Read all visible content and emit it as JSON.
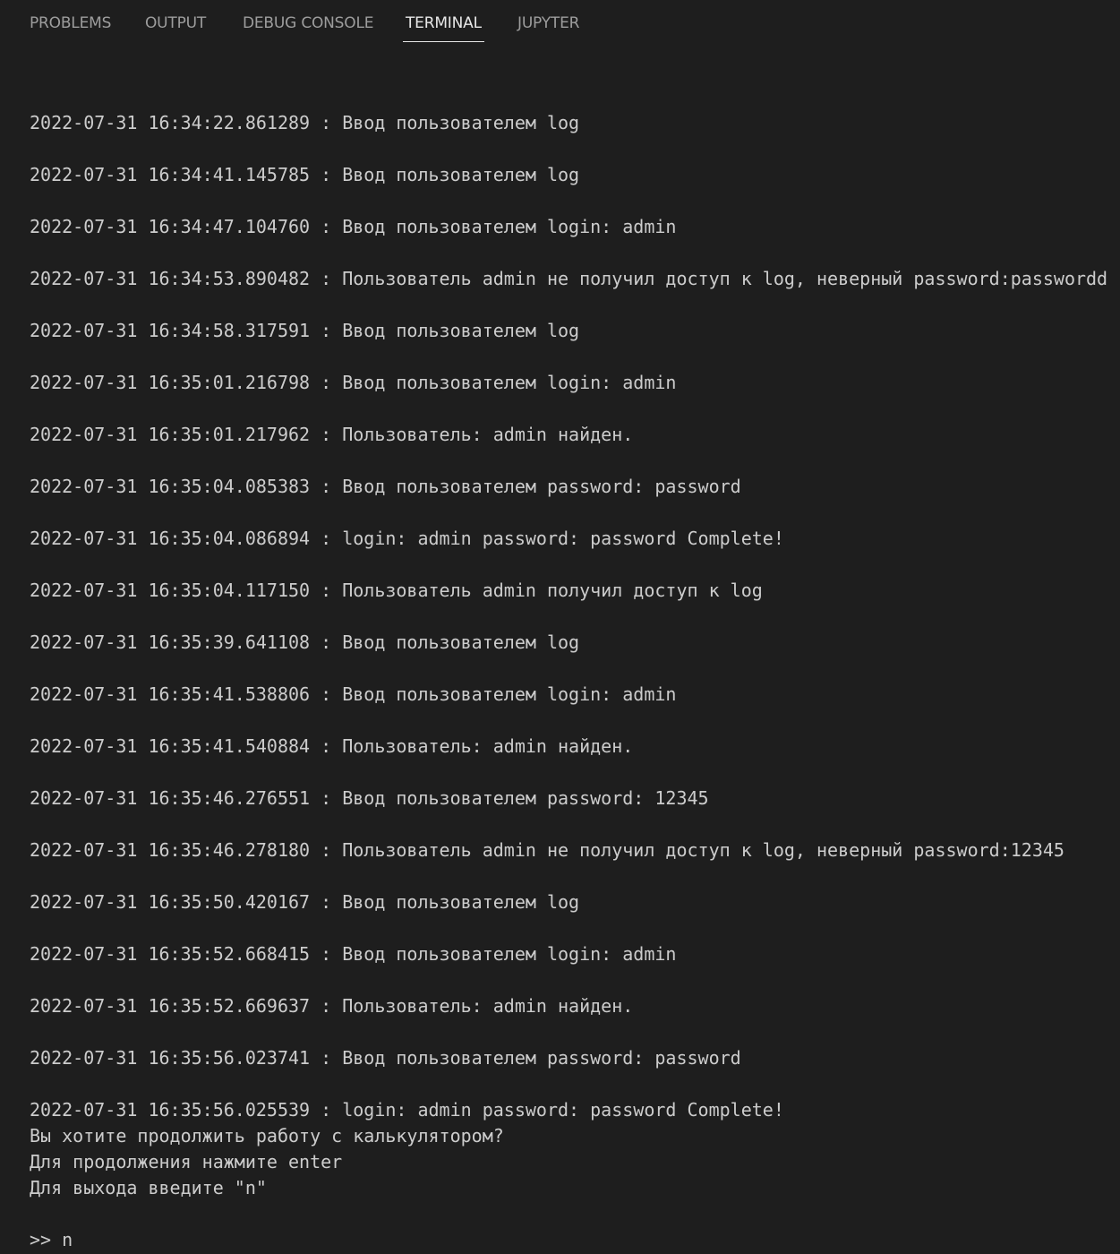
{
  "tabs": [
    {
      "label": "PROBLEMS",
      "active": false
    },
    {
      "label": "OUTPUT",
      "active": false
    },
    {
      "label": "DEBUG CONSOLE",
      "active": false
    },
    {
      "label": "TERMINAL",
      "active": true
    },
    {
      "label": "JUPYTER",
      "active": false
    }
  ],
  "terminal": {
    "log": [
      "2022-07-31 16:34:22.861289 : Ввод пользователем log",
      "2022-07-31 16:34:41.145785 : Ввод пользователем log",
      "2022-07-31 16:34:47.104760 : Ввод пользователем login: admin",
      "2022-07-31 16:34:53.890482 : Пользователь admin не получил доступ к log, неверный password:passwordd",
      "2022-07-31 16:34:58.317591 : Ввод пользователем log",
      "2022-07-31 16:35:01.216798 : Ввод пользователем login: admin",
      "2022-07-31 16:35:01.217962 : Пользователь: admin найден.",
      "2022-07-31 16:35:04.085383 : Ввод пользователем password: password",
      "2022-07-31 16:35:04.086894 : login: admin password: password Complete!",
      "2022-07-31 16:35:04.117150 : Пользователь admin получил доступ к log",
      "2022-07-31 16:35:39.641108 : Ввод пользователем log",
      "2022-07-31 16:35:41.538806 : Ввод пользователем login: admin",
      "2022-07-31 16:35:41.540884 : Пользователь: admin найден.",
      "2022-07-31 16:35:46.276551 : Ввод пользователем password: 12345",
      "2022-07-31 16:35:46.278180 : Пользователь admin не получил доступ к log, неверный password:12345",
      "2022-07-31 16:35:50.420167 : Ввод пользователем log",
      "2022-07-31 16:35:52.668415 : Ввод пользователем login: admin",
      "2022-07-31 16:35:52.669637 : Пользователь: admin найден.",
      "2022-07-31 16:35:56.023741 : Ввод пользователем password: password",
      "2022-07-31 16:35:56.025539 : login: admin password: password Complete!"
    ],
    "messages": [
      "Вы хотите продолжить работу с калькулятором?",
      "Для продолжения нажмите enter",
      "Для выхода введите \"n\""
    ],
    "prompt": ">> n"
  },
  "colors": {
    "background": "#1e1e1e",
    "text": "#cccccc",
    "tab_inactive": "#9d9d9d",
    "tab_active": "#e7e7e7"
  }
}
